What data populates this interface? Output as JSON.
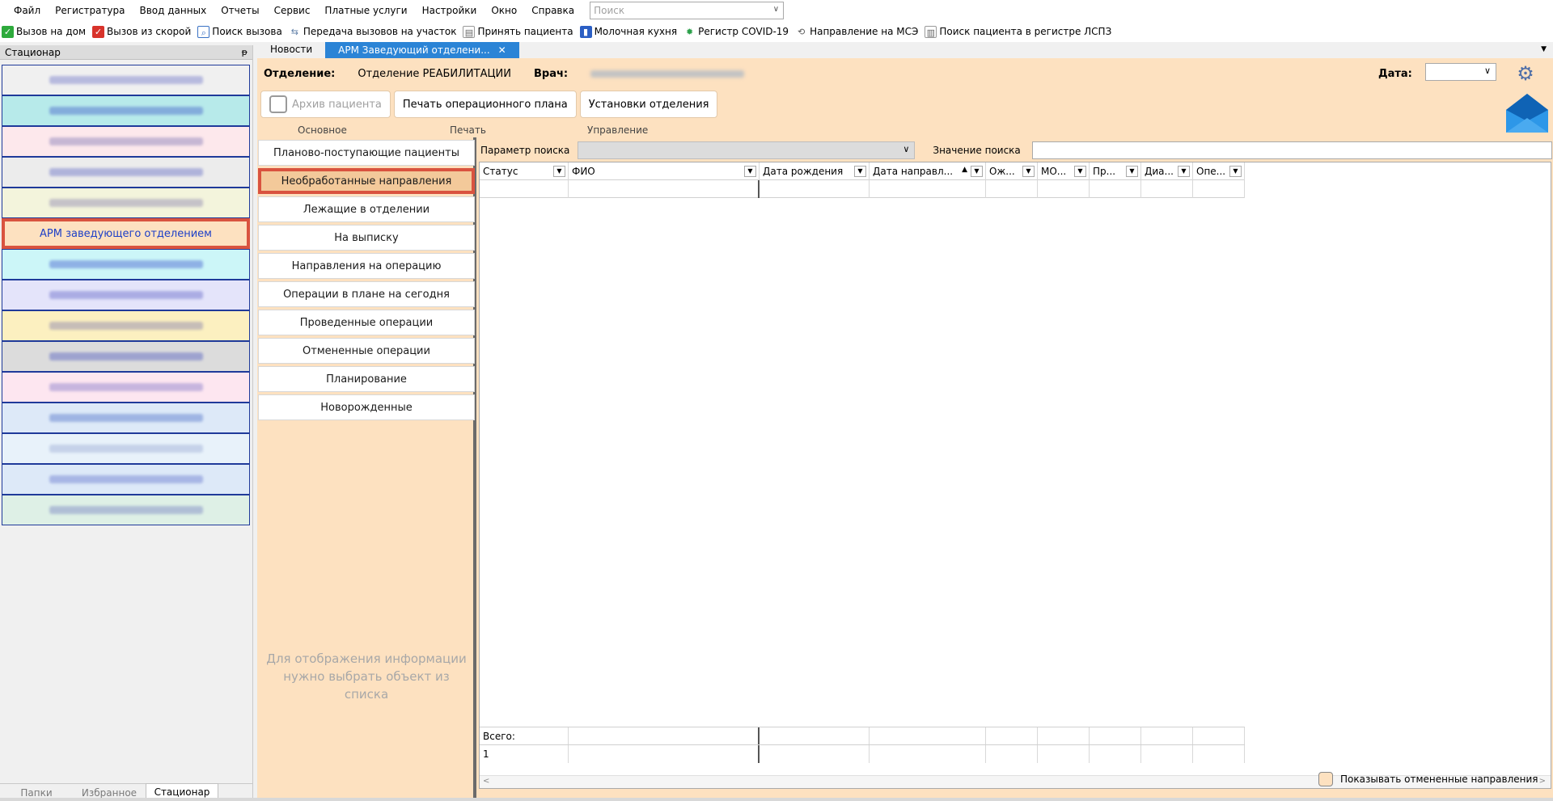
{
  "menubar": {
    "items": [
      "Файл",
      "Регистратура",
      "Ввод данных",
      "Отчеты",
      "Сервис",
      "Платные услуги",
      "Настройки",
      "Окно",
      "Справка"
    ],
    "search_placeholder": "Поиск"
  },
  "toolbar": {
    "items": [
      {
        "label": "Вызов на дом",
        "icon": "home-call-icon",
        "color": "#2eaa3c"
      },
      {
        "label": "Вызов из скорой",
        "icon": "ambulance-call-icon",
        "color": "#d8332b"
      },
      {
        "label": "Поиск вызова",
        "icon": "search-call-icon",
        "color": "#3a72c4"
      },
      {
        "label": "Передача вызовов на участок",
        "icon": "transfer-icon",
        "color": "#5c7ca6"
      },
      {
        "label": "Принять пациента",
        "icon": "accept-patient-icon",
        "color": "#6a6a6a"
      },
      {
        "label": "Молочная кухня",
        "icon": "milk-kitchen-icon",
        "color": "#2b5fc4"
      },
      {
        "label": "Регистр COVID-19",
        "icon": "covid-icon",
        "color": "#2ba04a"
      },
      {
        "label": "Направление на МСЭ",
        "icon": "mse-icon",
        "color": "#555555"
      },
      {
        "label": "Поиск пациента в регистре ЛСПЗ",
        "icon": "registry-search-icon",
        "color": "#666666"
      }
    ]
  },
  "left_panel": {
    "title": "Стационар",
    "pin": "ᵽ",
    "items": [
      {
        "label": "",
        "bg": "#f0f0f0",
        "bar": "#8a8fd0"
      },
      {
        "label": "",
        "bg": "#b7eaea",
        "bar": "#5a7ad0"
      },
      {
        "label": "",
        "bg": "#fde8ec",
        "bar": "#9a8fc0"
      },
      {
        "label": "",
        "bg": "#ececec",
        "bar": "#7f86cc"
      },
      {
        "label": "",
        "bg": "#f3f4dc",
        "bar": "#a09ab8"
      },
      {
        "label": "АРМ заведующего отделением",
        "bg": "#fde1c0",
        "selected": true
      },
      {
        "label": "",
        "bg": "#ccf6f8",
        "bar": "#5c7ad6"
      },
      {
        "label": "",
        "bg": "#e4e4fa",
        "bar": "#7d80d2"
      },
      {
        "label": "",
        "bg": "#fcf0c0",
        "bar": "#9a94b0"
      },
      {
        "label": "",
        "bg": "#dcdcdc",
        "bar": "#6a74c4"
      },
      {
        "label": "",
        "bg": "#fde6f0",
        "bar": "#9c8ed0"
      },
      {
        "label": "",
        "bg": "#dde9f8",
        "bar": "#6d8ad2"
      },
      {
        "label": "",
        "bg": "#e8f2fa",
        "bar": "#a9b8dc"
      },
      {
        "label": "",
        "bg": "#dde9f8",
        "bar": "#7d8dd6"
      },
      {
        "label": "",
        "bg": "#def0e6",
        "bar": "#8a96c8"
      }
    ],
    "tabs": [
      "Папки",
      "Избранное",
      "Стационар"
    ]
  },
  "doc_tabs": [
    "Новости",
    "АРМ Заведующий отделени..."
  ],
  "header": {
    "dept_label": "Отделение:",
    "dept_value": "Отделение РЕАБИЛИТАЦИИ",
    "doctor_label": "Врач:",
    "date_label": "Дата:"
  },
  "ribbon": {
    "buttons": [
      "Архив пациента",
      "Печать операционного плана",
      "Установки отделения"
    ],
    "groups": [
      "Основное",
      "Печать",
      "Управление"
    ]
  },
  "nav": {
    "items": [
      "Планово-поступающие пациенты",
      "Необработанные направления",
      "Лежащие в отделении",
      "На выписку",
      "Направления на операцию",
      "Операции в плане на сегодня",
      "Проведенные операции",
      "Отмененные операции",
      "Планирование",
      "Новорожденные"
    ],
    "active_index": 1,
    "hint": "Для отображения информации нужно выбрать объект из списка"
  },
  "search": {
    "param_label": "Параметр поиска",
    "value_label": "Значение поиска"
  },
  "grid": {
    "columns": [
      "Статус",
      "ФИО",
      "Дата рождения",
      "Дата направл...",
      "Ож...",
      "МО...",
      "Пр...",
      "Диа...",
      "Опе..."
    ],
    "total_label": "Всего:",
    "total_count": "1"
  },
  "show_cancelled_label": "Показывать отмененные направления",
  "colors": {
    "accent": "#2b84d6",
    "highlight": "#d9533f",
    "panel_bg": "#fde1c0"
  }
}
